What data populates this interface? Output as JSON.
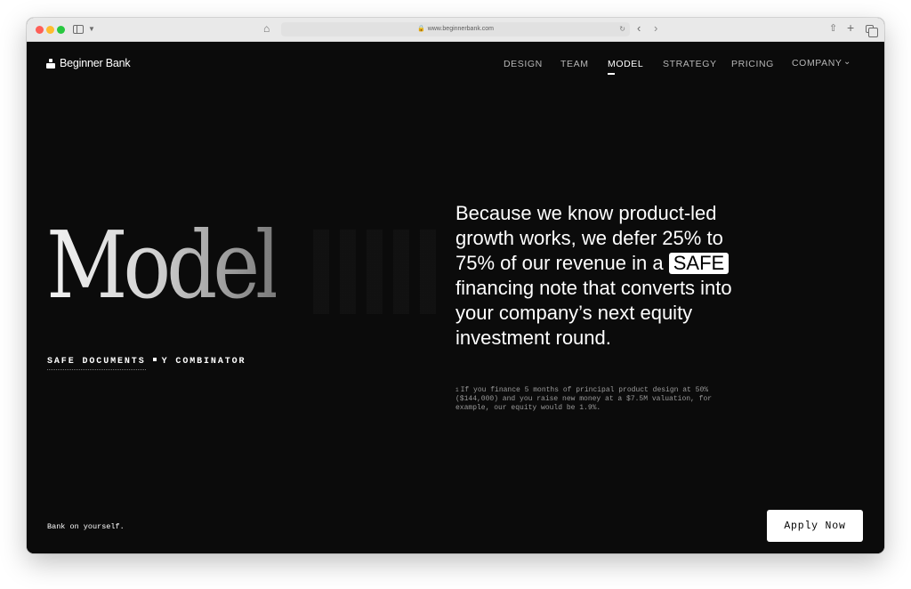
{
  "browser": {
    "url": "www.beginnerbank.com"
  },
  "site": {
    "logo_text": "Beginner Bank"
  },
  "nav": {
    "items": [
      {
        "label": "DESIGN"
      },
      {
        "label": "TEAM"
      },
      {
        "label": "MODEL",
        "active": true
      },
      {
        "label": "STRATEGY"
      },
      {
        "label": "PRICING"
      },
      {
        "label": "COMPANY",
        "has_dropdown": true
      }
    ]
  },
  "hero": {
    "title": "Model",
    "tagline_left": "SAFE DOCUMENTS",
    "tagline_right": "Y COMBINATOR",
    "text_before_badge": "Because we know product-led growth works, we defer 25% to 75% of our revenue in a",
    "badge": "SAFE",
    "text_after_badge": "financing note that converts into your company’s next equity investment round.",
    "footnote_marker": "1",
    "footnote": "If you finance 5 months of principal product design at 50% ($144,000) and you raise new money at a $7.5M valuation, for example, our equity would be 1.9%."
  },
  "footer": {
    "slogan": "Bank on yourself.",
    "cta": "Apply Now"
  },
  "colors": {
    "page_bg": "#0b0b0b",
    "text": "#ffffff",
    "nav_inactive": "#b6b6b6"
  }
}
